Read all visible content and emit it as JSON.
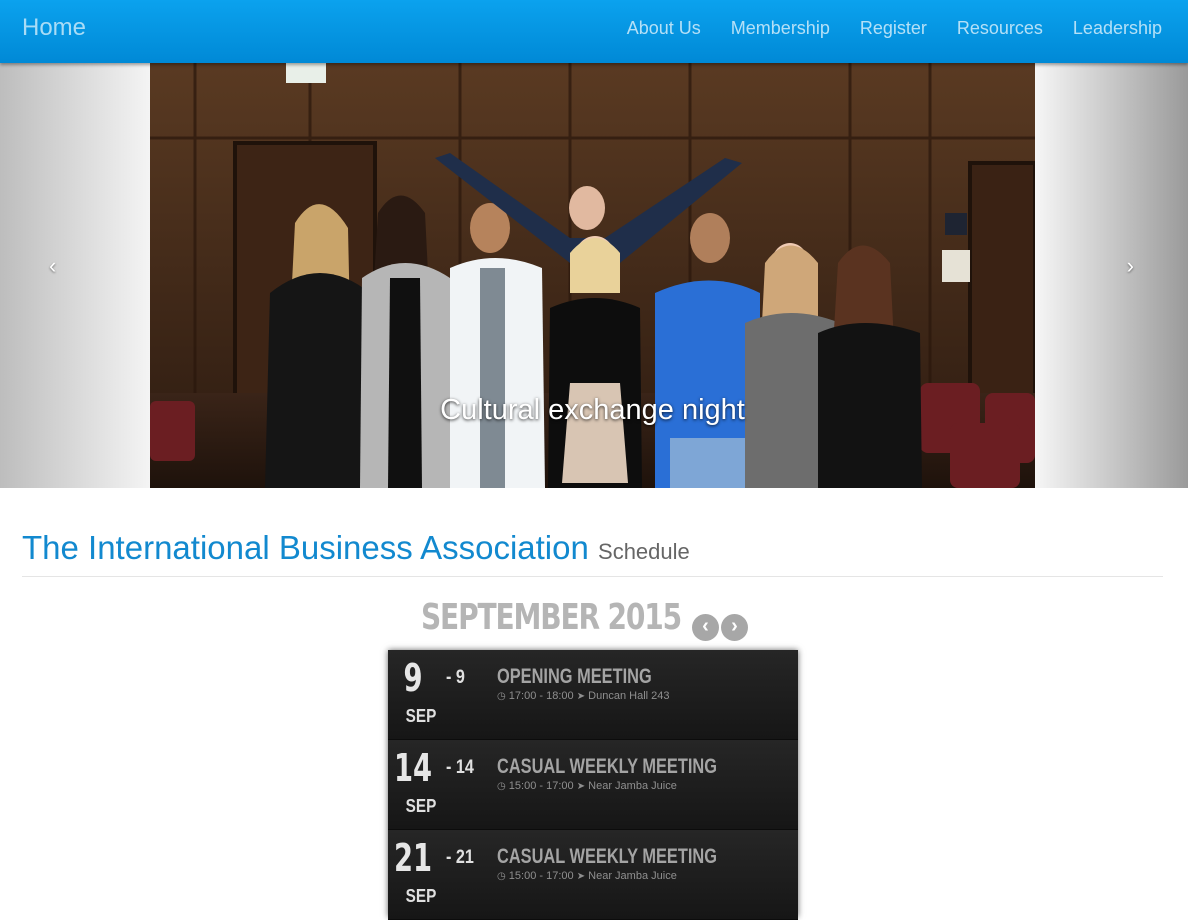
{
  "navbar": {
    "brand": "Home",
    "links": [
      "About Us",
      "Membership",
      "Register",
      "Resources",
      "Leadership"
    ]
  },
  "carousel": {
    "caption": "Cultural exchange night",
    "prev_icon": "‹",
    "next_icon": "›"
  },
  "header": {
    "title": "The International Business Association",
    "subtitle": "Schedule"
  },
  "calendar": {
    "month": "SEPTEMBER 2015",
    "prev_icon": "‹",
    "next_icon": "›",
    "events": [
      {
        "day": "9",
        "end": "- 9",
        "month": "SEP",
        "title": "OPENING MEETING",
        "time": "17:00 - 18:00",
        "location": "Duncan Hall 243"
      },
      {
        "day": "14",
        "end": "- 14",
        "month": "SEP",
        "title": "CASUAL WEEKLY MEETING",
        "time": "15:00 - 17:00",
        "location": "Near Jamba Juice"
      },
      {
        "day": "21",
        "end": "- 21",
        "month": "SEP",
        "title": "CASUAL WEEKLY MEETING",
        "time": "15:00 - 17:00",
        "location": "Near Jamba Juice"
      }
    ]
  }
}
